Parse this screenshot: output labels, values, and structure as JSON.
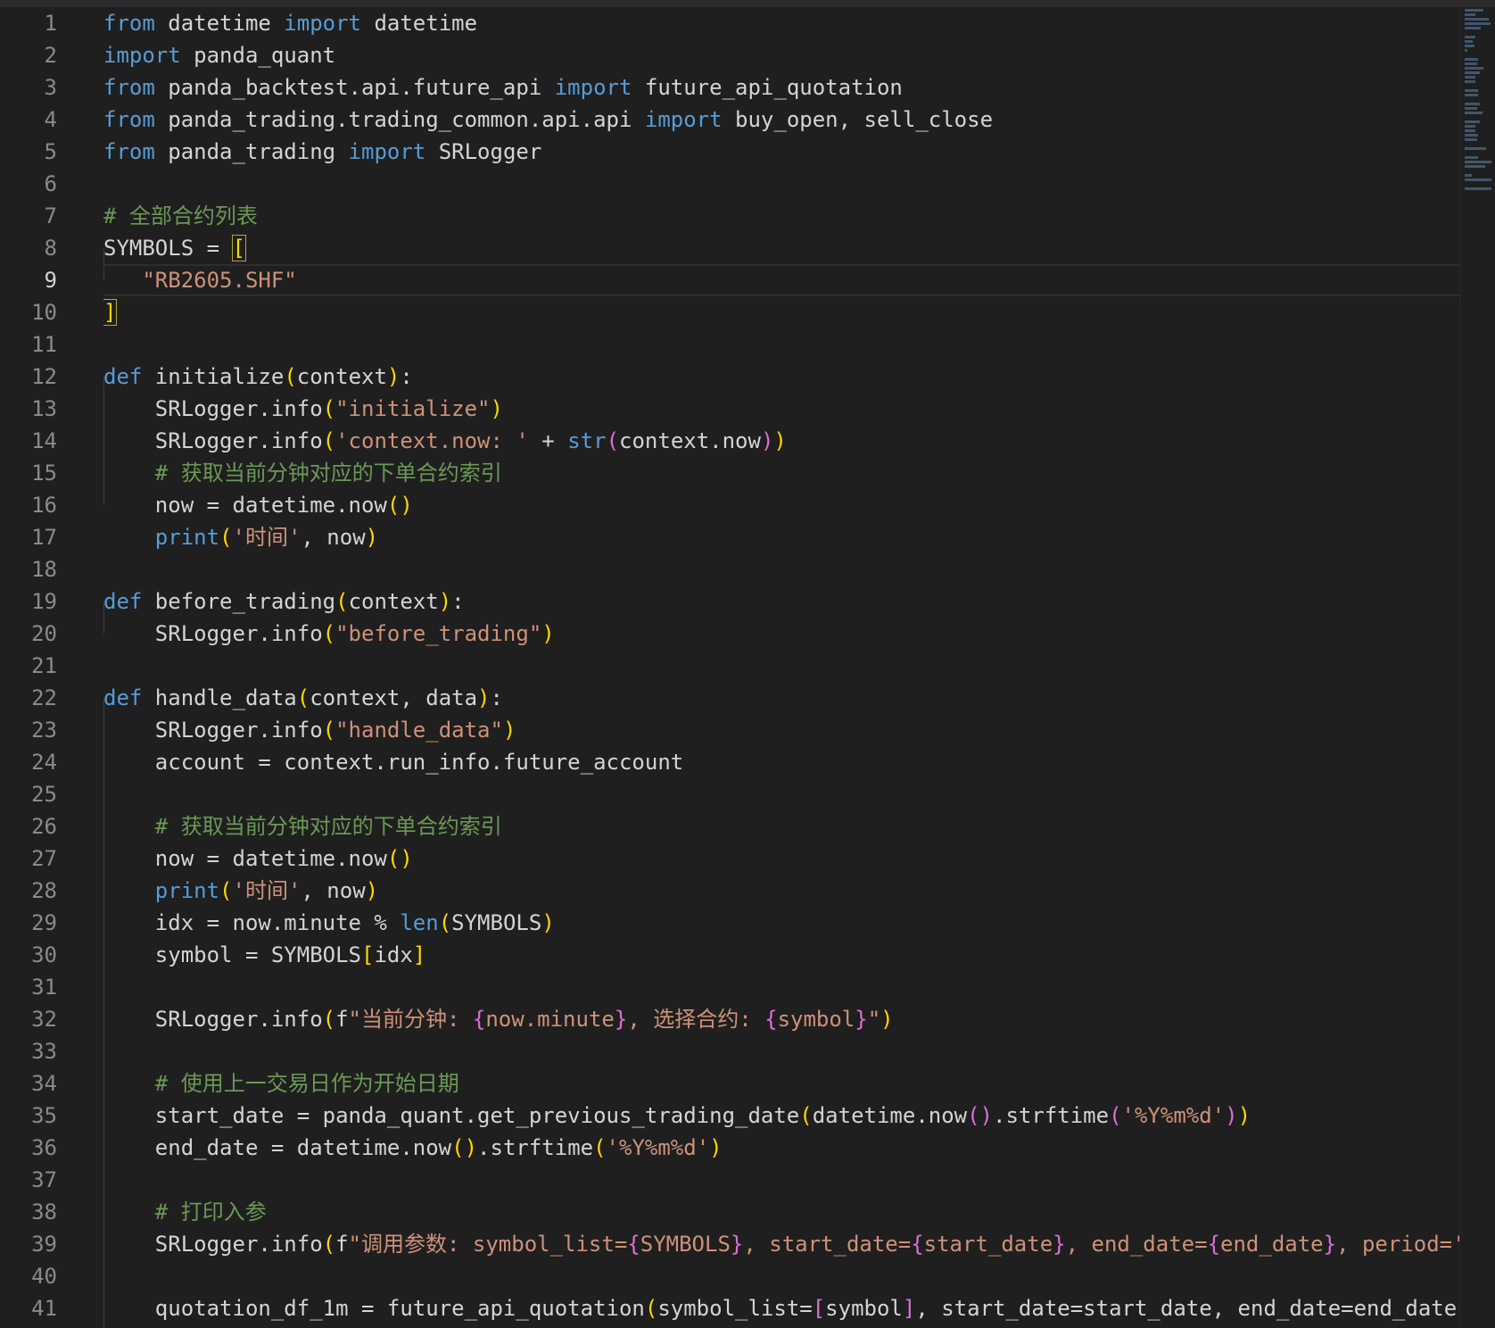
{
  "editor": {
    "active_line": 9,
    "lines": [
      {
        "n": "1",
        "t": [
          [
            "kw",
            "from"
          ],
          [
            "",
            " datetime "
          ],
          [
            "kw",
            "import"
          ],
          [
            "",
            " datetime"
          ]
        ]
      },
      {
        "n": "2",
        "t": [
          [
            "kw",
            "import"
          ],
          [
            "",
            " panda_quant"
          ]
        ]
      },
      {
        "n": "3",
        "t": [
          [
            "kw",
            "from"
          ],
          [
            "",
            " panda_backtest.api.future_api "
          ],
          [
            "kw",
            "import"
          ],
          [
            "",
            " future_api_quotation"
          ]
        ]
      },
      {
        "n": "4",
        "t": [
          [
            "kw",
            "from"
          ],
          [
            "",
            " panda_trading.trading_common.api.api "
          ],
          [
            "kw",
            "import"
          ],
          [
            "",
            " buy_open, sell_close"
          ]
        ]
      },
      {
        "n": "5",
        "t": [
          [
            "kw",
            "from"
          ],
          [
            "",
            " panda_trading "
          ],
          [
            "kw",
            "import"
          ],
          [
            "",
            " SRLogger"
          ]
        ]
      },
      {
        "n": "6",
        "t": []
      },
      {
        "n": "7",
        "t": [
          [
            "cm",
            "# 全部合约列表"
          ]
        ]
      },
      {
        "n": "8",
        "t": [
          [
            "",
            "SYMBOLS = "
          ],
          [
            "p1 bm",
            "["
          ]
        ]
      },
      {
        "n": "9",
        "t": [
          [
            "",
            "   "
          ],
          [
            "str",
            "\"RB2605.SHF\""
          ]
        ]
      },
      {
        "n": "10",
        "t": [
          [
            "p1 bm",
            "]"
          ]
        ]
      },
      {
        "n": "11",
        "t": []
      },
      {
        "n": "12",
        "t": [
          [
            "kw",
            "def"
          ],
          [
            "",
            " initialize"
          ],
          [
            "p1",
            "("
          ],
          [
            "",
            "context"
          ],
          [
            "p1",
            ")"
          ],
          [
            "",
            ":"
          ]
        ]
      },
      {
        "n": "13",
        "t": [
          [
            "",
            "    SRLogger.info"
          ],
          [
            "p1",
            "("
          ],
          [
            "str",
            "\"initialize\""
          ],
          [
            "p1",
            ")"
          ]
        ]
      },
      {
        "n": "14",
        "t": [
          [
            "",
            "    SRLogger.info"
          ],
          [
            "p1",
            "("
          ],
          [
            "str",
            "'context.now: '"
          ],
          [
            "",
            " + "
          ],
          [
            "bi",
            "str"
          ],
          [
            "p2",
            "("
          ],
          [
            "",
            "context.now"
          ],
          [
            "p2",
            ")"
          ],
          [
            "p1",
            ")"
          ]
        ]
      },
      {
        "n": "15",
        "t": [
          [
            "cm",
            "    # 获取当前分钟对应的下单合约索引"
          ]
        ]
      },
      {
        "n": "16",
        "t": [
          [
            "",
            "    now = datetime.now"
          ],
          [
            "p1",
            "()"
          ]
        ]
      },
      {
        "n": "17",
        "t": [
          [
            "",
            "    "
          ],
          [
            "bi",
            "print"
          ],
          [
            "p1",
            "("
          ],
          [
            "str",
            "'时间'"
          ],
          [
            "",
            ", now"
          ],
          [
            "p1",
            ")"
          ]
        ]
      },
      {
        "n": "18",
        "t": []
      },
      {
        "n": "19",
        "t": [
          [
            "kw",
            "def"
          ],
          [
            "",
            " before_trading"
          ],
          [
            "p1",
            "("
          ],
          [
            "",
            "context"
          ],
          [
            "p1",
            ")"
          ],
          [
            "",
            ":"
          ]
        ]
      },
      {
        "n": "20",
        "t": [
          [
            "",
            "    SRLogger.info"
          ],
          [
            "p1",
            "("
          ],
          [
            "str",
            "\"before_trading\""
          ],
          [
            "p1",
            ")"
          ]
        ]
      },
      {
        "n": "21",
        "t": []
      },
      {
        "n": "22",
        "t": [
          [
            "kw",
            "def"
          ],
          [
            "",
            " handle_data"
          ],
          [
            "p1",
            "("
          ],
          [
            "",
            "context, data"
          ],
          [
            "p1",
            ")"
          ],
          [
            "",
            ":"
          ]
        ]
      },
      {
        "n": "23",
        "t": [
          [
            "",
            "    SRLogger.info"
          ],
          [
            "p1",
            "("
          ],
          [
            "str",
            "\"handle_data\""
          ],
          [
            "p1",
            ")"
          ]
        ]
      },
      {
        "n": "24",
        "t": [
          [
            "",
            "    account = context.run_info.future_account"
          ]
        ]
      },
      {
        "n": "25",
        "t": []
      },
      {
        "n": "26",
        "t": [
          [
            "cm",
            "    # 获取当前分钟对应的下单合约索引"
          ]
        ]
      },
      {
        "n": "27",
        "t": [
          [
            "",
            "    now = datetime.now"
          ],
          [
            "p1",
            "()"
          ]
        ]
      },
      {
        "n": "28",
        "t": [
          [
            "",
            "    "
          ],
          [
            "bi",
            "print"
          ],
          [
            "p1",
            "("
          ],
          [
            "str",
            "'时间'"
          ],
          [
            "",
            ", now"
          ],
          [
            "p1",
            ")"
          ]
        ]
      },
      {
        "n": "29",
        "t": [
          [
            "",
            "    idx = now.minute % "
          ],
          [
            "bi",
            "len"
          ],
          [
            "p1",
            "("
          ],
          [
            "",
            "SYMBOLS"
          ],
          [
            "p1",
            ")"
          ]
        ]
      },
      {
        "n": "30",
        "t": [
          [
            "",
            "    symbol = SYMBOLS"
          ],
          [
            "p1",
            "["
          ],
          [
            "",
            "idx"
          ],
          [
            "p1",
            "]"
          ]
        ]
      },
      {
        "n": "31",
        "t": []
      },
      {
        "n": "32",
        "t": [
          [
            "",
            "    SRLogger.info"
          ],
          [
            "p1",
            "("
          ],
          [
            "",
            "f"
          ],
          [
            "str",
            "\"当前分钟: "
          ],
          [
            "p2",
            "{"
          ],
          [
            "str",
            "now.minute"
          ],
          [
            "p2",
            "}"
          ],
          [
            "str",
            ", 选择合约: "
          ],
          [
            "p2",
            "{"
          ],
          [
            "str",
            "symbol"
          ],
          [
            "p2",
            "}"
          ],
          [
            "str",
            "\""
          ],
          [
            "p1",
            ")"
          ]
        ]
      },
      {
        "n": "33",
        "t": []
      },
      {
        "n": "34",
        "t": [
          [
            "cm",
            "    # 使用上一交易日作为开始日期"
          ]
        ]
      },
      {
        "n": "35",
        "t": [
          [
            "",
            "    start_date = panda_quant.get_previous_trading_date"
          ],
          [
            "p1",
            "("
          ],
          [
            "",
            "datetime.now"
          ],
          [
            "p2",
            "()"
          ],
          [
            "",
            ".strftime"
          ],
          [
            "p2",
            "("
          ],
          [
            "str",
            "'%Y%m%d'"
          ],
          [
            "p2",
            ")"
          ],
          [
            "p1",
            ")"
          ]
        ]
      },
      {
        "n": "36",
        "t": [
          [
            "",
            "    end_date = datetime.now"
          ],
          [
            "p1",
            "()"
          ],
          [
            "",
            ".strftime"
          ],
          [
            "p1",
            "("
          ],
          [
            "str",
            "'%Y%m%d'"
          ],
          [
            "p1",
            ")"
          ]
        ]
      },
      {
        "n": "37",
        "t": []
      },
      {
        "n": "38",
        "t": [
          [
            "cm",
            "    # 打印入参"
          ]
        ]
      },
      {
        "n": "39",
        "t": [
          [
            "",
            "    SRLogger.info"
          ],
          [
            "p1",
            "("
          ],
          [
            "",
            "f"
          ],
          [
            "str",
            "\"调用参数: symbol_list="
          ],
          [
            "p2",
            "{"
          ],
          [
            "str",
            "SYMBOLS"
          ],
          [
            "p2",
            "}"
          ],
          [
            "str",
            ", start_date="
          ],
          [
            "p2",
            "{"
          ],
          [
            "str",
            "start_date"
          ],
          [
            "p2",
            "}"
          ],
          [
            "str",
            ", end_date="
          ],
          [
            "p2",
            "{"
          ],
          [
            "str",
            "end_date"
          ],
          [
            "p2",
            "}"
          ],
          [
            "str",
            ", period='"
          ]
        ]
      },
      {
        "n": "40",
        "t": []
      },
      {
        "n": "41",
        "t": [
          [
            "",
            "    quotation_df_1m = future_api_quotation"
          ],
          [
            "p1",
            "("
          ],
          [
            "",
            "symbol_list="
          ],
          [
            "p2",
            "["
          ],
          [
            "",
            "symbol"
          ],
          [
            "p2",
            "]"
          ],
          [
            "",
            ", start_date=start_date, end_date=end_date"
          ]
        ]
      }
    ]
  },
  "colors": {
    "background": "#1f1f1f",
    "keyword": "#569cd6",
    "string": "#ce9178",
    "comment": "#6a9955",
    "bracket_level1": "#ffd700",
    "bracket_level2": "#da70d6"
  }
}
